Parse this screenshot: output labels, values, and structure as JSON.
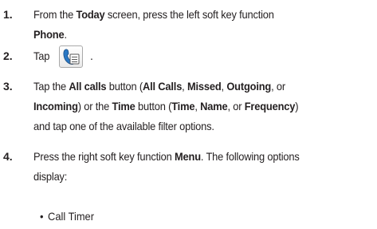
{
  "steps": [
    {
      "num": "1.",
      "pre": "From the ",
      "b1": "Today",
      "mid": " screen, press the left soft key function",
      "b2": "Phone",
      "post": "."
    },
    {
      "num": "2.",
      "pre": "Tap",
      "icon": "phone-call-log-icon",
      "post": "."
    },
    {
      "num": "3.",
      "t1": "Tap the ",
      "b1": "All calls",
      "t2": " button (",
      "b2": "All Calls",
      "t3": ", ",
      "b3": "Missed",
      "t4": ", ",
      "b4": "Outgoing",
      "t5": ", or",
      "b5": "Incoming",
      "t6": ") or the ",
      "b6": "Time",
      "t7": " button (",
      "b7": "Time",
      "t8": ", ",
      "b8": "Name",
      "t9": ", or ",
      "b9": "Frequency",
      "t10": ")",
      "t11": "and tap one of the available filter options."
    },
    {
      "num": "4.",
      "t1": "Press the right soft key function ",
      "b1": "Menu",
      "t2": ". The following options",
      "t3": "display:"
    }
  ],
  "bullets": [
    {
      "marker": "•",
      "text": "Call Timer"
    }
  ]
}
